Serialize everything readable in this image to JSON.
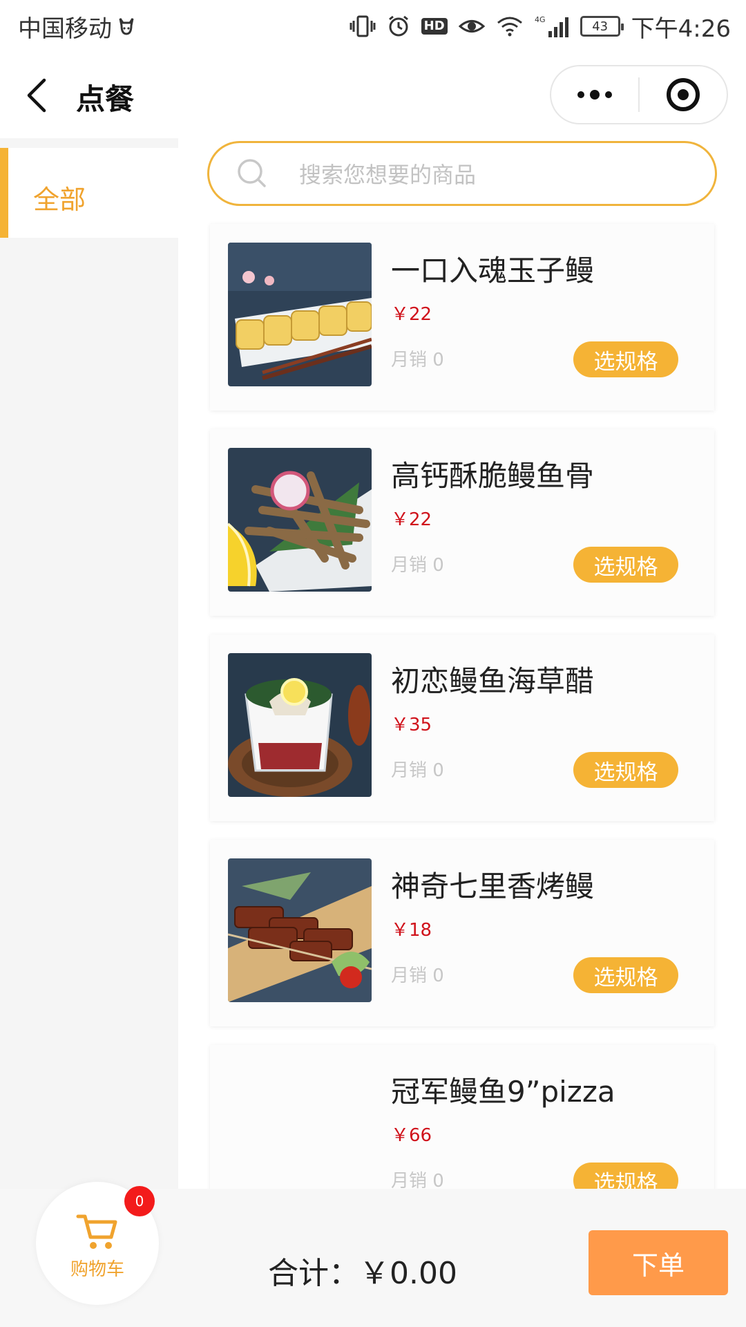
{
  "status_bar": {
    "carrier": "中国移动",
    "network": "4G",
    "battery": "43",
    "time": "下午4:26"
  },
  "nav": {
    "title": "点餐"
  },
  "sidebar": {
    "categories": [
      {
        "label": "全部",
        "selected": true
      }
    ]
  },
  "search": {
    "placeholder": "搜索您想要的商品"
  },
  "items": [
    {
      "name": "一口入魂玉子鳗",
      "price": "￥22",
      "sales": "月销 0",
      "spec_label": "选规格",
      "image": "eel-roll-photo"
    },
    {
      "name": "高钙酥脆鳗鱼骨",
      "price": "￥22",
      "sales": "月销 0",
      "spec_label": "选规格",
      "image": "fried-eel-bone-photo"
    },
    {
      "name": "初恋鳗鱼海草醋",
      "price": "￥35",
      "sales": "月销 0",
      "spec_label": "选规格",
      "image": "eel-seaweed-bowl-photo"
    },
    {
      "name": "神奇七里香烤鳗",
      "price": "￥18",
      "sales": "月销 0",
      "spec_label": "选规格",
      "image": "grilled-eel-skewer-photo"
    },
    {
      "name": "冠军鳗鱼9”pizza",
      "price": "￥66",
      "sales": "月销 0",
      "spec_label": "选规格",
      "image": ""
    }
  ],
  "bottom": {
    "cart_label": "购物车",
    "cart_count": "0",
    "total": "合计：￥0.00",
    "order_label": "下单"
  },
  "colors": {
    "accent": "#f5b335",
    "price": "#d0121b",
    "order_button": "#ff9a4a",
    "badge": "#f31b1b"
  }
}
